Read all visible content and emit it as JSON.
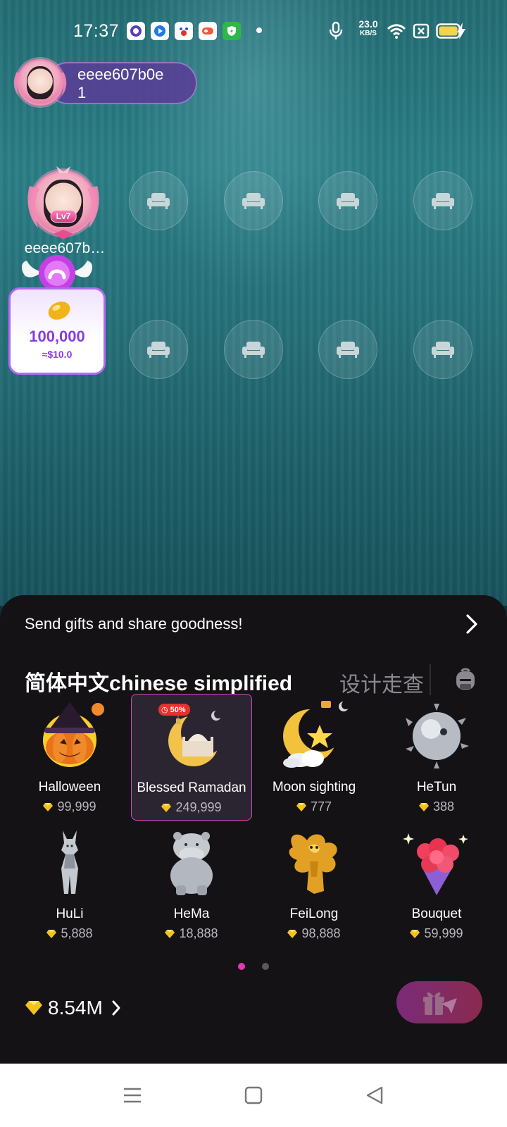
{
  "status_bar": {
    "time": "17:37",
    "net_speed_value": "23.0",
    "net_speed_unit": "KB/S",
    "app_icons": [
      "browser-icon",
      "player-icon",
      "baidu-icon",
      "game-icon",
      "security-icon"
    ],
    "system_icons": [
      "mic-icon",
      "wifi-icon",
      "no-sim-icon",
      "battery-icon",
      "charging-icon"
    ]
  },
  "room": {
    "owner": {
      "name_line1": "eeee607b0e",
      "name_line2": "1"
    },
    "host_seat": {
      "name": "eeee607b…",
      "level": "Lv7"
    },
    "empty_seat_icon": "sofa-icon",
    "lucky_coin": {
      "amount": "100,000",
      "usd": "≈$10.0"
    }
  },
  "gift_panel": {
    "promo_text": "Send gifts and share goodness!",
    "tabs": {
      "active": "简体中文chinese simplified",
      "inactive": "设计走查"
    },
    "gifts": [
      {
        "name": "Halloween",
        "price": "99,999",
        "selected": false
      },
      {
        "name": "Blessed Ramadan",
        "price": "249,999",
        "selected": true,
        "badge": "50%"
      },
      {
        "name": "Moon sighting",
        "price": "777",
        "selected": false
      },
      {
        "name": "HeTun",
        "price": "388",
        "selected": false
      },
      {
        "name": "HuLi",
        "price": "5,888",
        "selected": false
      },
      {
        "name": "HeMa",
        "price": "18,888",
        "selected": false
      },
      {
        "name": "FeiLong",
        "price": "98,888",
        "selected": false
      },
      {
        "name": "Bouquet",
        "price": "59,999",
        "selected": false
      }
    ],
    "pages": {
      "current": 1,
      "total": 2
    },
    "balance": "8.54M",
    "send_button_icon": "gift-send-icon"
  },
  "colors": {
    "accent": "#d147c9",
    "panel_bg": "#141215",
    "gem": "#f4c21c",
    "coin_text": "#8a3be0"
  }
}
